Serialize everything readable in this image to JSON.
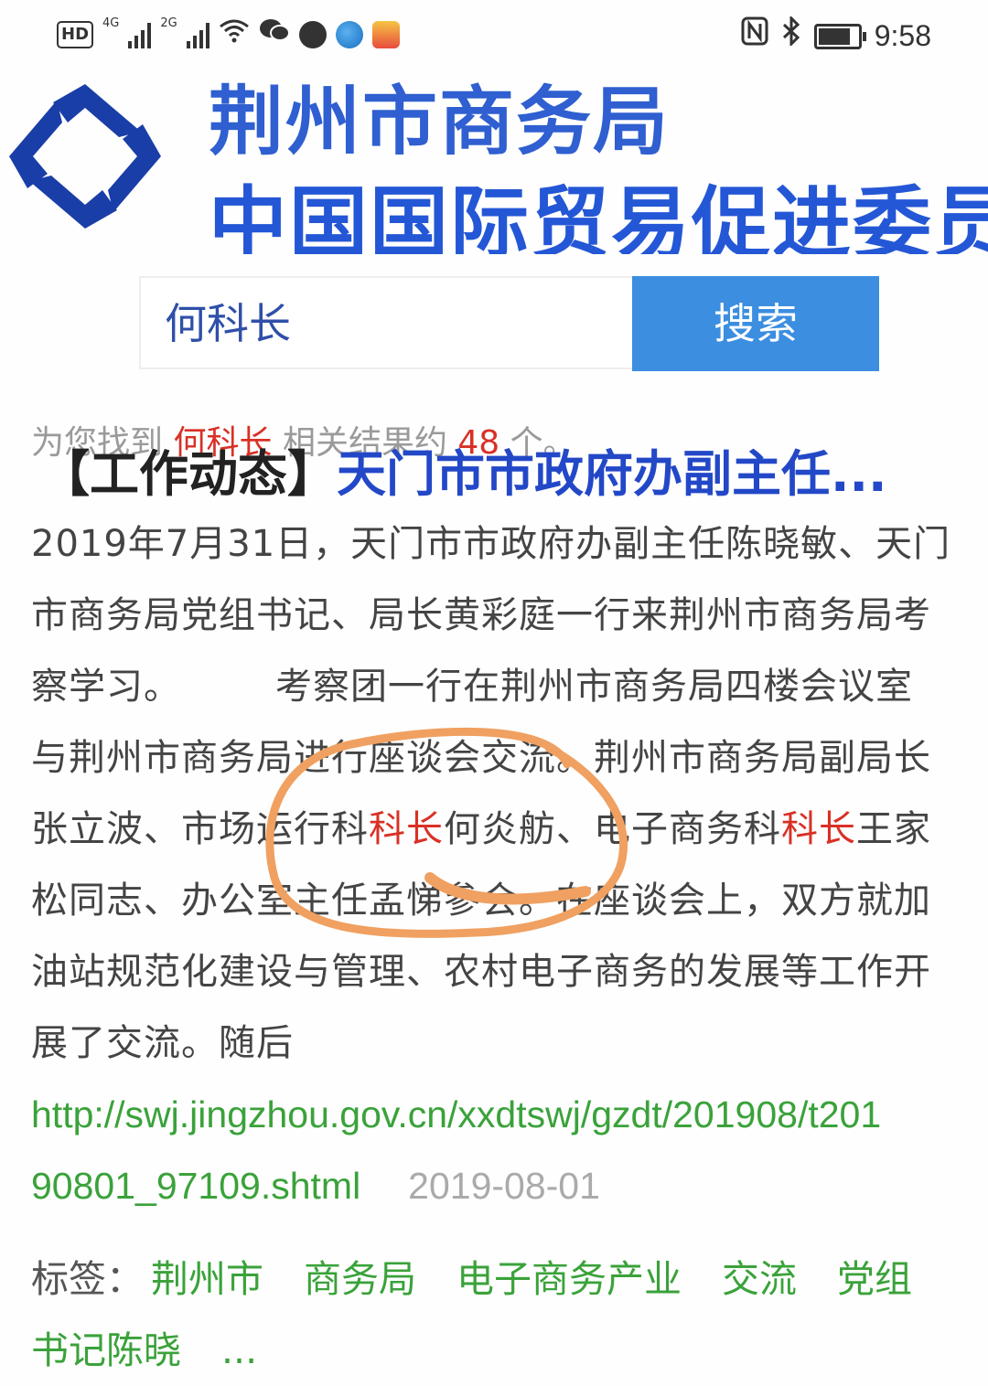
{
  "status_bar": {
    "hd_label": "HD",
    "sim1_tag": "4G",
    "sim2_tag": "2G",
    "time": "9:58",
    "battery_level": 0.9,
    "icons": [
      "nfc-icon",
      "bluetooth-icon",
      "battery-icon",
      "wifi-icon",
      "wechat-icon"
    ]
  },
  "banner": {
    "line1": "荆州市商务局",
    "line2": "中国国际贸易促进委员",
    "logo_color": "#1a3ea8"
  },
  "search": {
    "query": "何科长",
    "button_label": "搜索"
  },
  "summary": {
    "prefix": "为您找到",
    "keyword": "何科长",
    "middle": "相关结果约",
    "count": "48",
    "suffix": "个。"
  },
  "result": {
    "category": "【工作动态】",
    "title": "天门市市政府办副主任...",
    "snippet_lines": [
      [
        {
          "t": "2019年7月31日，天门市市政府办副主任陈晓敏、天门"
        }
      ],
      [
        {
          "t": "市商务局党组书记、局长黄彩庭一行来荆州市商务局考"
        }
      ],
      [
        {
          "t": "察学习。　　　考察团一行在荆州市商务局四楼会议室"
        }
      ],
      [
        {
          "t": "与荆州市商务局进行座谈会交流。荆州市商务局副局长"
        }
      ],
      [
        {
          "t": "张立波、市场运行科"
        },
        {
          "t": "科长",
          "hl": true
        },
        {
          "t": "何炎舫、电子商务科"
        },
        {
          "t": "科长",
          "hl": true
        },
        {
          "t": "王家"
        }
      ],
      [
        {
          "t": "松同志、办公室主任孟悌參会。在座谈会上，双方就加"
        }
      ],
      [
        {
          "t": "油站规范化建设与管理、农村电子商务的发展等工作开"
        }
      ],
      [
        {
          "t": "展了交流。随后"
        }
      ]
    ],
    "url_line1": "http://swj.jingzhou.gov.cn/xxdtswj/gzdt/201908/t201",
    "url_line2": "90801_97109.shtml",
    "date": "2019-08-01",
    "tags_label": "标签：",
    "tags": [
      "荆州市",
      "商务局",
      "电子商务产业",
      "交流",
      "党组"
    ],
    "tags_line2": [
      "书记陈晓"
    ],
    "more": "..."
  },
  "colors": {
    "accent_blue": "#3b8ee0",
    "title_blue": "#2348c7",
    "highlight_red": "#d93025",
    "link_green": "#3aa23a",
    "annotation_orange": "#f0a060"
  }
}
